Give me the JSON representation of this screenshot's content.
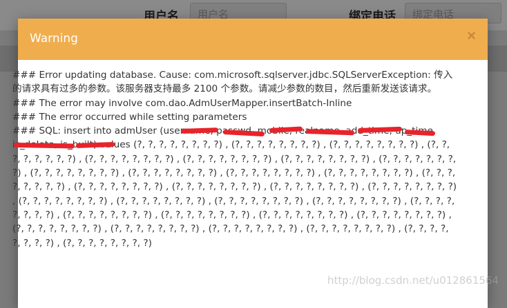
{
  "background": {
    "username_label": "用户名",
    "username_placeholder": "用户名",
    "phone_label": "绑定电话",
    "phone_placeholder": "绑定电话"
  },
  "dialog": {
    "title": "Warning",
    "close_label": "×",
    "lines": [
      "### Error updating database. Cause: com.microsoft.sqlserver.jdbc.SQLServerException: 传入的请求具有过多的参数。该服务器支持最多 2100 个参数。请减少参数的数目，然后重新发送该请求。",
      "### The error may involve com.dao.AdmUserMapper.insertBatch-Inline",
      "### The error occurred while setting parameters"
    ],
    "sql_text": "### SQL: insert into admUser (username, passwd, mobile, realname, add_time, up_time, is_delete, is_built) values (?, ?, ?, ?, ?, ?, ?, ?) , (?, ?, ?, ?, ?, ?, ?, ?) , (?, ?, ?, ?, ?, ?, ?, ?) , (?, ?, ?, ?, ?, ?, ?, ?) , (?, ?, ?, ?, ?, ?, ?, ?) , (?, ?, ?, ?, ?, ?, ?, ?) , (?, ?, ?, ?, ?, ?, ?, ?) , (?, ?, ?, ?, ?, ?, ?, ?) , (?, ?, ?, ?, ?, ?, ?, ?) , (?, ?, ?, ?, ?, ?, ?, ?) , (?, ?, ?, ?, ?, ?, ?, ?) , (?, ?, ?, ?, ?, ?, ?, ?) , (?, ?, ?, ?, ?, ?, ?, ?) , (?, ?, ?, ?, ?, ?, ?, ?) , (?, ?, ?, ?, ?, ?, ?, ?) , (?, ?, ?, ?, ?, ?, ?, ?) , (?, ?, ?, ?, ?, ?, ?, ?) , (?, ?, ?, ?, ?, ?, ?, ?) , (?, ?, ?, ?, ?, ?, ?, ?) , (?, ?, ?, ?, ?, ?, ?, ?) , (?, ?, ?, ?, ?, ?, ?, ?) , (?, ?, ?, ?, ?, ?, ?, ?) , (?, ?, ?, ?, ?, ?, ?, ?) , (?, ?, ?, ?, ?, ?, ?, ?) , (?, ?, ?, ?, ?, ?, ?, ?) , (?, ?, ?, ?, ?, ?, ?, ?) , (?, ?, ?, ?, ?, ?, ?, ?) , (?, ?, ?, ?, ?, ?, ?, ?) , (?, ?, ?, ?, ?, ?, ?, ?) , (?, ?, ?, ?, ?, ?, ?, ?) , (?, ?, ?, ?, ?, ?, ?, ?) , (?, ?, ?, ?, ?, ?, ?, ?)"
  },
  "watermark": "http://blog.csdn.net/u012861564",
  "colors": {
    "header": "#f0ad4e",
    "redaction": "#e8232a"
  }
}
